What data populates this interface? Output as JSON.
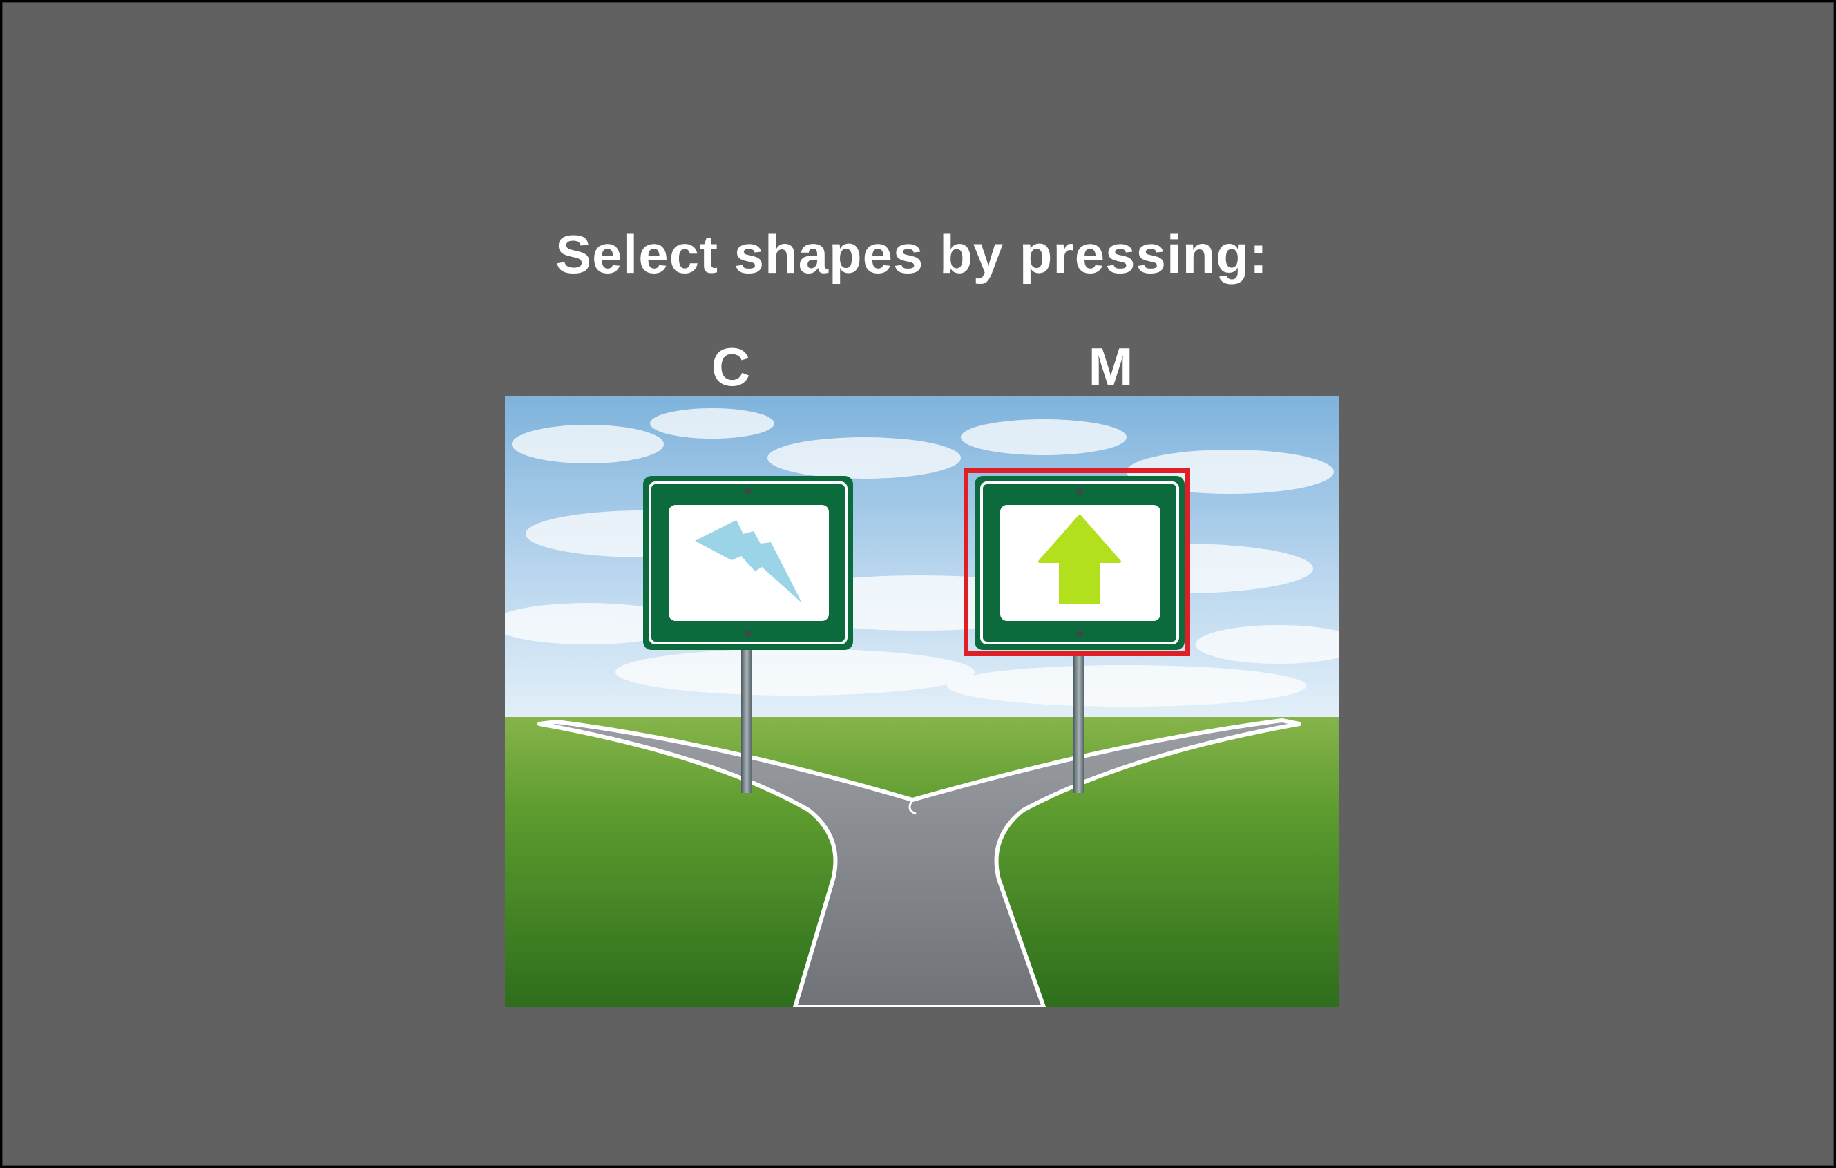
{
  "instruction": {
    "text": "Select shapes by pressing:"
  },
  "choices": [
    {
      "key": "C",
      "shape": "lightning-bolt",
      "shape_color": "#9ad4e6",
      "selected": false
    },
    {
      "key": "M",
      "shape": "arrow-up",
      "shape_color": "#b2e01c",
      "selected": true
    }
  ],
  "colors": {
    "background": "#616161",
    "sign_green": "#0c6b3c",
    "selection_outline": "#e01e26"
  }
}
